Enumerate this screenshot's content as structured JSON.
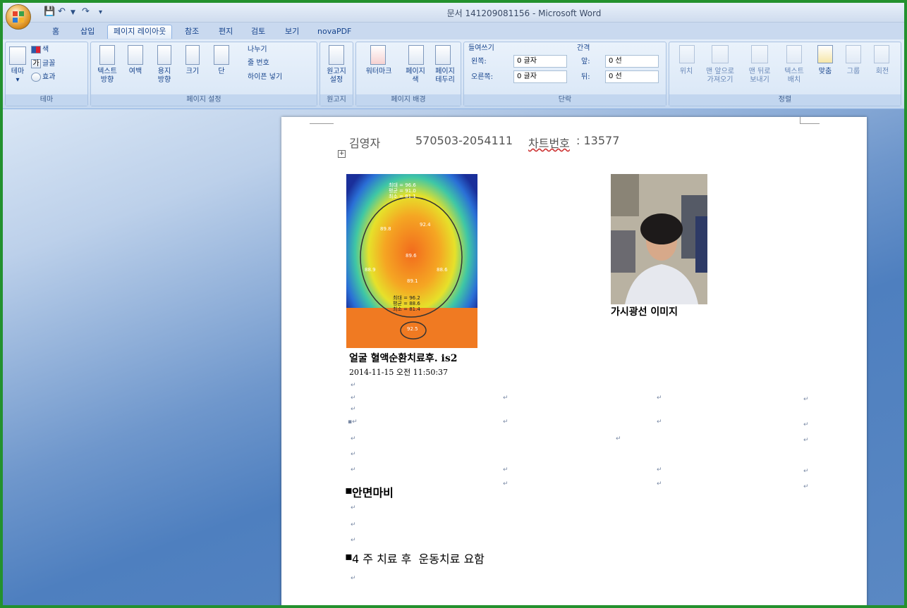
{
  "window": {
    "title": "문서 141209081156 - Microsoft Word"
  },
  "tabs": [
    "홈",
    "삽입",
    "페이지 레이아웃",
    "참조",
    "편지",
    "검토",
    "보기",
    "novaPDF"
  ],
  "active_tab": "페이지 레이아웃",
  "ribbon": {
    "theme": {
      "group": "테마",
      "theme_btn": "테마",
      "colors": "색",
      "fonts": "글꼴",
      "effects": "효과"
    },
    "page_setup": {
      "group": "페이지 설정",
      "text_dir": "텍스트\n방향",
      "margins": "여백",
      "orientation": "용지\n방향",
      "size": "크기",
      "columns": "단",
      "breaks": "나누기",
      "line_numbers": "줄 번호",
      "hyphenation": "하이픈 넣기"
    },
    "manuscript": {
      "group": "원고지",
      "setup": "원고지\n설정"
    },
    "page_bg": {
      "group": "페이지 배경",
      "watermark": "워터마크",
      "page_color": "페이지\n색",
      "page_border": "페이지\n테두리"
    },
    "paragraph": {
      "group": "단락",
      "indent": "들여쓰기",
      "left_label": "왼쪽:",
      "left_val": "0 글자",
      "right_label": "오른쪽:",
      "right_val": "0 글자",
      "spacing": "간격",
      "before_label": "앞:",
      "before_val": "0 선",
      "after_label": "뒤:",
      "after_val": "0 선"
    },
    "arrange": {
      "group": "정렬",
      "position": "위치",
      "bring_front": "맨 앞으로\n가져오기",
      "send_back": "맨 뒤로\n보내기",
      "text_wrap": "텍스트\n배치",
      "align": "맞춤",
      "group_btn": "그룹",
      "rotate": "회전"
    }
  },
  "document": {
    "header_name": "김영자",
    "header_id": "570503-2054111",
    "header_chart_label": "차트번호",
    "header_chart_num": ": 13577",
    "thermal_caption": "얼굴 혈액순환치료후. is2",
    "thermal_date": "2014-11-15 오전 11:50:37",
    "photo_caption": "가시광선 이미지",
    "diagnosis": "안면마비",
    "note": "4 주 치료 후  운동치료 요함",
    "thermal_labels": [
      "최대 = 96.6",
      "평균 = 91.0",
      "최소 = 81.1",
      "89.8",
      "92.4",
      "89.6",
      "88.9",
      "89.1",
      "88.6",
      "최대 = 96.2",
      "평균 = 88.6",
      "최소 = 81.4",
      "92.5"
    ]
  }
}
